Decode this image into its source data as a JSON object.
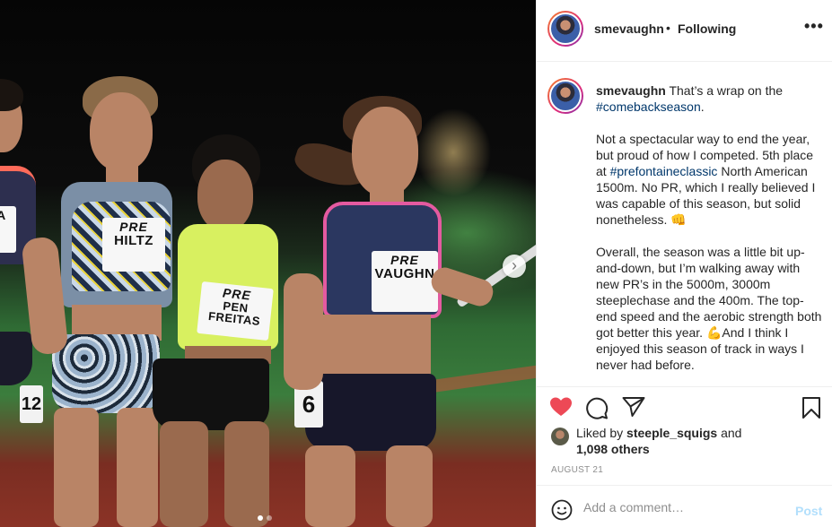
{
  "post": {
    "username": "smevaughn",
    "header_separator": "•",
    "follow_status": "Following",
    "more_label": "•••",
    "caption": {
      "line1_text": "That’s a wrap on the",
      "hashtag1": "#comebackseason",
      "line1_end": ".",
      "p2_a": "Not a spectacular way to end the year, but proud of how I competed. 5th place at",
      "hashtag2": "#prefontaineclassic",
      "p2_b": "North American 1500m. No PR, which I really believed I was capable of this season, but solid nonetheless. 👊",
      "p3": "Overall, the season was a little bit up-and-down, but I’m walking away with new PR’s in the 5000m, 3000m steeplechase and the 400m. The top-end speed and the aerobic strength both got better this year. 💪And I think I enjoyed this season of track in ways I never had before."
    },
    "likes": {
      "prefix": "Liked by",
      "liker": "steeple_squigs",
      "and": "and",
      "others": "1,098 others"
    },
    "date": "AUGUST 21",
    "comment": {
      "placeholder": "Add a comment…",
      "post_label": "Post"
    }
  },
  "media": {
    "bibs": [
      {
        "brand": "PRE",
        "name": "HILTZ"
      },
      {
        "brand": "PRE",
        "name": "PEN FREITAS"
      },
      {
        "brand": "PRE",
        "name": "VAUGHN"
      }
    ],
    "hip_numbers": [
      "12",
      "6"
    ],
    "carousel_next": "›",
    "carousel_position": {
      "current": 1,
      "total": 2
    }
  },
  "colors": {
    "like_red": "#ed4956",
    "hashtag_blue": "#00376b",
    "post_disabled": "#b2dffc",
    "muted_gray": "#8e8e8e"
  }
}
